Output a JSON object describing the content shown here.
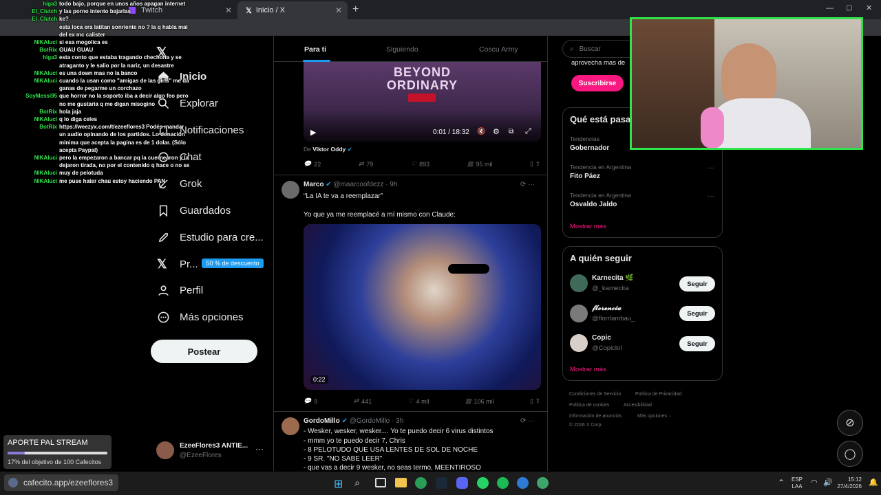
{
  "browser": {
    "tabs": [
      {
        "label": "Twitch",
        "icon": "twitch-icon"
      },
      {
        "label": "Inicio / X",
        "icon": "x-logo-icon"
      }
    ],
    "new_tab": "+",
    "window_controls": [
      "minimize",
      "maximize",
      "close"
    ]
  },
  "nav": {
    "items": [
      {
        "label": "Inicio",
        "icon": "home-icon"
      },
      {
        "label": "Explorar",
        "icon": "search-icon"
      },
      {
        "label": "Notificaciones",
        "icon": "bell-icon"
      },
      {
        "label": "Chat",
        "icon": "chat-icon"
      },
      {
        "label": "Grok",
        "icon": "grok-icon"
      },
      {
        "label": "Guardados",
        "icon": "bookmark-icon"
      },
      {
        "label": "Estudio para cre...",
        "icon": "rocket-icon"
      },
      {
        "label": "Pr...",
        "icon": "x-logo-icon"
      },
      {
        "label": "Perfil",
        "icon": "person-icon"
      },
      {
        "label": "Más opciones",
        "icon": "more-icon"
      }
    ],
    "premium_badge": "50 % de descuento",
    "post_button": "Postear",
    "account": {
      "name": "EzeeFlores3 ANTIE...",
      "handle": "@EzeeFlores"
    }
  },
  "timeline": {
    "tabs": [
      "Para ti",
      "Siguiendo",
      "Coscu Army"
    ],
    "video1": {
      "banner_line1": "BEYOND",
      "banner_line2": "ORDINARY",
      "time": "0:01 / 18:32",
      "credit_prefix": "De",
      "credit_name": "Viktor Oddy"
    },
    "tweet1_actions": {
      "replies": "22",
      "retweets": "79",
      "likes": "893",
      "views": "95 mil"
    },
    "tweet2": {
      "name": "Marco",
      "handle": "@maarcoofdezz",
      "time": "· 9h",
      "line1": "“La IA te va a reemplazar”",
      "line2": "Yo que ya me reemplacé a mí mismo con Claude:",
      "video_duration": "0:22",
      "actions": {
        "replies": "9",
        "retweets": "441",
        "likes": "4 mil",
        "views": "106 mil"
      }
    },
    "tweet3": {
      "name": "GordoMillo",
      "handle": "@GordoMillo",
      "time": "· 3h",
      "lines": [
        "- Wesker, wesker, wesker.... Yo te puedo decir 6 virus distintos",
        "- mmm yo te puedo decir 7, Chris",
        "- 8 PELOTUDO QUE USA LENTES DE SOL DE NOCHE",
        "- 9 SR. \"NO SABE LEER\"",
        "- que vas a decir 9 wesker, no seas termo, MEENTIROSO"
      ]
    }
  },
  "right": {
    "search_placeholder": "Buscar",
    "premium_text": "aprovecha mas de",
    "subscribe_button": "Suscribirse",
    "trends_title": "Qué está pasa",
    "trends": [
      {
        "category": "Tendencias",
        "name": "Gobernador"
      },
      {
        "category": "Tendencia en Argentina",
        "name": "Fito Páez"
      },
      {
        "category": "Tendencia en Argentina",
        "name": "Osvaldo Jaldo"
      }
    ],
    "show_more": "Mostrar más",
    "who_to_follow_title": "A quién seguir",
    "follow_suggestions": [
      {
        "name": "Karnecita 🌿",
        "handle": "@_karnecita"
      },
      {
        "name": "𝓯𝓵𝓸𝓻𝓮𝓷𝓬𝓲𝓪",
        "handle": "@florrlambau_"
      },
      {
        "name": "Copic",
        "handle": "@Copiclol"
      }
    ],
    "follow_label": "Seguir",
    "footer": {
      "row1": [
        "Condiciones de Servicio",
        "Política de Privacidad"
      ],
      "row2": [
        "Política de cookies",
        "Accesibilidad"
      ],
      "row3": [
        "Información de anuncios",
        "Más opciones ···"
      ],
      "copyright": "© 2026 X Corp."
    }
  },
  "chat": [
    {
      "user": "higa3",
      "text": "todo bajo, porque en unos años apagan internet"
    },
    {
      "user": "EI_Clutch",
      "text": "y las porno intento bajarlas"
    },
    {
      "user": "EI_Clutch",
      "text": "ke?"
    },
    {
      "user": "",
      "text": "esta loca era latitan sonriente no ? la q habla mal"
    },
    {
      "user": "",
      "text": "del ex mc calister"
    },
    {
      "user": "NIKAluci",
      "text": "si esa mogolica es"
    },
    {
      "user": "BotRix",
      "text": "GUAU GUAU"
    },
    {
      "user": "higa3",
      "text": "esta conto que estaba tragando chechona y se"
    },
    {
      "user": "",
      "text": "atraganto y le salio por la nariz, un desastre"
    },
    {
      "user": "NIKAluci",
      "text": "es una down mas no la banco"
    },
    {
      "user": "NIKAluci",
      "text": "cuando la usan como \"amigas de las girls\" me da"
    },
    {
      "user": "",
      "text": "ganas de pegarme un corchazo"
    },
    {
      "user": "SoyMessi95",
      "text": "que horror no la soporto iba a decir algo feo pero"
    },
    {
      "user": "",
      "text": "no me gustaria q me digan misogino"
    },
    {
      "user": "BotRix",
      "text": "hola jaja"
    },
    {
      "user": "NIKAluci",
      "text": "q lo diga celes"
    },
    {
      "user": "BotRix",
      "text": "https://weezyx.com/t/ezeeflores3 Podés mandar"
    },
    {
      "user": "",
      "text": "un audio opinando de los partidos. Lo donación"
    },
    {
      "user": "",
      "text": "minima que acepta la pagina es de 1 dolar. (Sólo"
    },
    {
      "user": "",
      "text": "acepta Paypal)"
    },
    {
      "user": "NIKAluci",
      "text": "pero la empezaron a bancar pq la cuernearon y la"
    },
    {
      "user": "",
      "text": "dejaron tirada, no por el contenido q hace o no se"
    },
    {
      "user": "NIKAluci",
      "text": "muy de pelotuda"
    },
    {
      "user": "NIKAluci",
      "text": "me puse hater chau estoy haciendo PAN"
    }
  ],
  "donation": {
    "title": "APORTE PAL STREAM",
    "progress_text": "17% del objetivo de 100 Cafecitos",
    "progress_fraction": 0.17,
    "url": "cafecito.app/ezeeflores3"
  },
  "taskbar": {
    "lang": "ESP",
    "lang2": "LAA",
    "time": "15:12",
    "date": "27/4/2026"
  },
  "colors": {
    "accent": "#1d9bf0",
    "brand_pink": "#f91880",
    "chat_green": "#2fe34a"
  }
}
